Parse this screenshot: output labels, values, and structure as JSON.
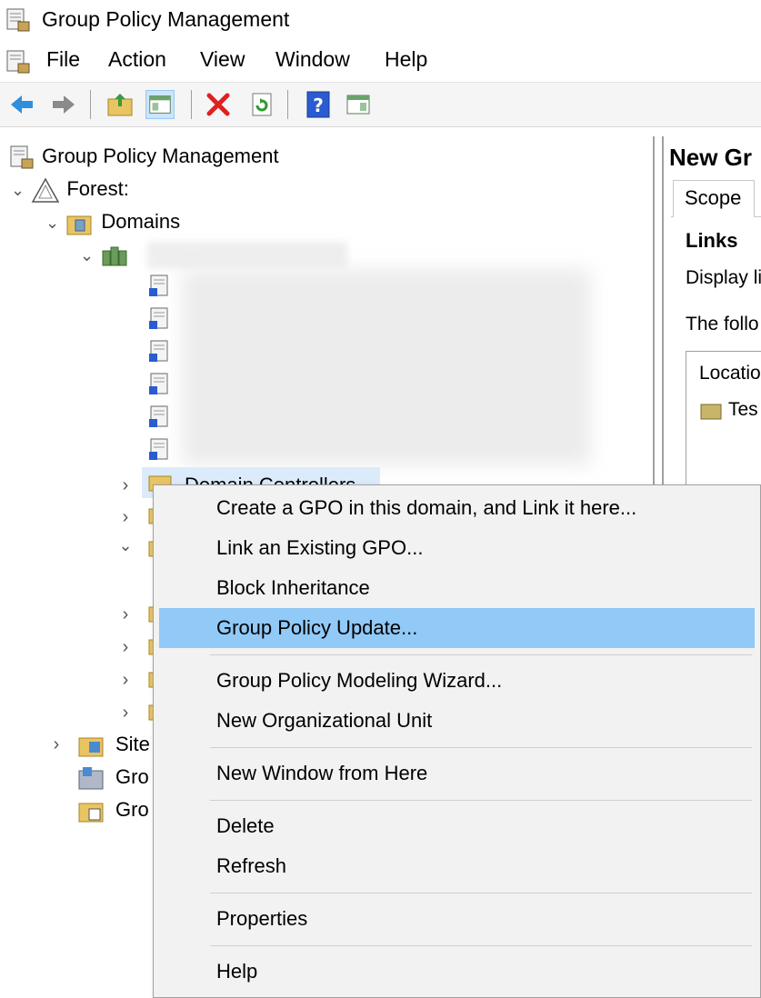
{
  "window": {
    "title": "Group Policy Management"
  },
  "menubar": {
    "items": [
      "File",
      "Action",
      "View",
      "Window",
      "Help"
    ]
  },
  "toolbar": {
    "icons": [
      "back-arrow-icon",
      "forward-arrow-icon",
      "up-folder-icon",
      "show-hide-tree-icon",
      "delete-icon",
      "refresh-icon",
      "help-icon",
      "properties-icon"
    ]
  },
  "tree": {
    "root": "Group Policy Management",
    "forest": "Forest:",
    "domains": "Domains",
    "domain_controllers": "Domain Controllers",
    "sites": "Site",
    "gpm1": "Gro",
    "gpm2": "Gro"
  },
  "right": {
    "title": "New Gr",
    "tab": "Scope",
    "links_heading": "Links",
    "display_text": "Display li",
    "following_text": "The follo",
    "column": "Locatio",
    "row1": "Tes"
  },
  "context_menu": {
    "items": [
      "Create a GPO in this domain, and Link it here...",
      "Link an Existing GPO...",
      "Block Inheritance",
      "Group Policy Update...",
      "Group Policy Modeling Wizard...",
      "New Organizational Unit",
      "New Window from Here",
      "Delete",
      "Refresh",
      "Properties",
      "Help"
    ],
    "highlighted": "Group Policy Update..."
  },
  "colors": {
    "highlight": "#91c9f7",
    "menu_bg": "#f2f2f2"
  }
}
